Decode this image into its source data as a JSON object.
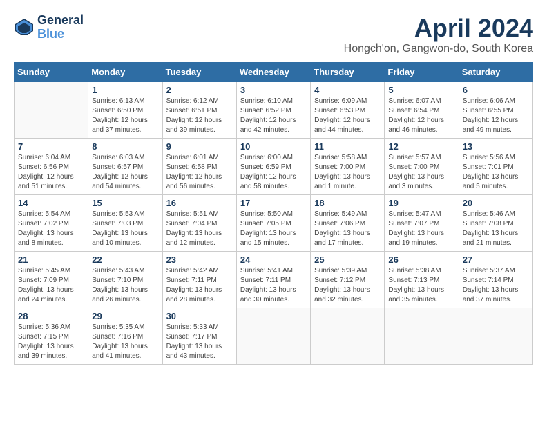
{
  "header": {
    "logo_line1": "General",
    "logo_line2": "Blue",
    "month": "April 2024",
    "location": "Hongch'on, Gangwon-do, South Korea"
  },
  "weekdays": [
    "Sunday",
    "Monday",
    "Tuesday",
    "Wednesday",
    "Thursday",
    "Friday",
    "Saturday"
  ],
  "weeks": [
    [
      {
        "day": "",
        "info": ""
      },
      {
        "day": "1",
        "info": "Sunrise: 6:13 AM\nSunset: 6:50 PM\nDaylight: 12 hours\nand 37 minutes."
      },
      {
        "day": "2",
        "info": "Sunrise: 6:12 AM\nSunset: 6:51 PM\nDaylight: 12 hours\nand 39 minutes."
      },
      {
        "day": "3",
        "info": "Sunrise: 6:10 AM\nSunset: 6:52 PM\nDaylight: 12 hours\nand 42 minutes."
      },
      {
        "day": "4",
        "info": "Sunrise: 6:09 AM\nSunset: 6:53 PM\nDaylight: 12 hours\nand 44 minutes."
      },
      {
        "day": "5",
        "info": "Sunrise: 6:07 AM\nSunset: 6:54 PM\nDaylight: 12 hours\nand 46 minutes."
      },
      {
        "day": "6",
        "info": "Sunrise: 6:06 AM\nSunset: 6:55 PM\nDaylight: 12 hours\nand 49 minutes."
      }
    ],
    [
      {
        "day": "7",
        "info": "Sunrise: 6:04 AM\nSunset: 6:56 PM\nDaylight: 12 hours\nand 51 minutes."
      },
      {
        "day": "8",
        "info": "Sunrise: 6:03 AM\nSunset: 6:57 PM\nDaylight: 12 hours\nand 54 minutes."
      },
      {
        "day": "9",
        "info": "Sunrise: 6:01 AM\nSunset: 6:58 PM\nDaylight: 12 hours\nand 56 minutes."
      },
      {
        "day": "10",
        "info": "Sunrise: 6:00 AM\nSunset: 6:59 PM\nDaylight: 12 hours\nand 58 minutes."
      },
      {
        "day": "11",
        "info": "Sunrise: 5:58 AM\nSunset: 7:00 PM\nDaylight: 13 hours\nand 1 minute."
      },
      {
        "day": "12",
        "info": "Sunrise: 5:57 AM\nSunset: 7:00 PM\nDaylight: 13 hours\nand 3 minutes."
      },
      {
        "day": "13",
        "info": "Sunrise: 5:56 AM\nSunset: 7:01 PM\nDaylight: 13 hours\nand 5 minutes."
      }
    ],
    [
      {
        "day": "14",
        "info": "Sunrise: 5:54 AM\nSunset: 7:02 PM\nDaylight: 13 hours\nand 8 minutes."
      },
      {
        "day": "15",
        "info": "Sunrise: 5:53 AM\nSunset: 7:03 PM\nDaylight: 13 hours\nand 10 minutes."
      },
      {
        "day": "16",
        "info": "Sunrise: 5:51 AM\nSunset: 7:04 PM\nDaylight: 13 hours\nand 12 minutes."
      },
      {
        "day": "17",
        "info": "Sunrise: 5:50 AM\nSunset: 7:05 PM\nDaylight: 13 hours\nand 15 minutes."
      },
      {
        "day": "18",
        "info": "Sunrise: 5:49 AM\nSunset: 7:06 PM\nDaylight: 13 hours\nand 17 minutes."
      },
      {
        "day": "19",
        "info": "Sunrise: 5:47 AM\nSunset: 7:07 PM\nDaylight: 13 hours\nand 19 minutes."
      },
      {
        "day": "20",
        "info": "Sunrise: 5:46 AM\nSunset: 7:08 PM\nDaylight: 13 hours\nand 21 minutes."
      }
    ],
    [
      {
        "day": "21",
        "info": "Sunrise: 5:45 AM\nSunset: 7:09 PM\nDaylight: 13 hours\nand 24 minutes."
      },
      {
        "day": "22",
        "info": "Sunrise: 5:43 AM\nSunset: 7:10 PM\nDaylight: 13 hours\nand 26 minutes."
      },
      {
        "day": "23",
        "info": "Sunrise: 5:42 AM\nSunset: 7:11 PM\nDaylight: 13 hours\nand 28 minutes."
      },
      {
        "day": "24",
        "info": "Sunrise: 5:41 AM\nSunset: 7:11 PM\nDaylight: 13 hours\nand 30 minutes."
      },
      {
        "day": "25",
        "info": "Sunrise: 5:39 AM\nSunset: 7:12 PM\nDaylight: 13 hours\nand 32 minutes."
      },
      {
        "day": "26",
        "info": "Sunrise: 5:38 AM\nSunset: 7:13 PM\nDaylight: 13 hours\nand 35 minutes."
      },
      {
        "day": "27",
        "info": "Sunrise: 5:37 AM\nSunset: 7:14 PM\nDaylight: 13 hours\nand 37 minutes."
      }
    ],
    [
      {
        "day": "28",
        "info": "Sunrise: 5:36 AM\nSunset: 7:15 PM\nDaylight: 13 hours\nand 39 minutes."
      },
      {
        "day": "29",
        "info": "Sunrise: 5:35 AM\nSunset: 7:16 PM\nDaylight: 13 hours\nand 41 minutes."
      },
      {
        "day": "30",
        "info": "Sunrise: 5:33 AM\nSunset: 7:17 PM\nDaylight: 13 hours\nand 43 minutes."
      },
      {
        "day": "",
        "info": ""
      },
      {
        "day": "",
        "info": ""
      },
      {
        "day": "",
        "info": ""
      },
      {
        "day": "",
        "info": ""
      }
    ]
  ]
}
